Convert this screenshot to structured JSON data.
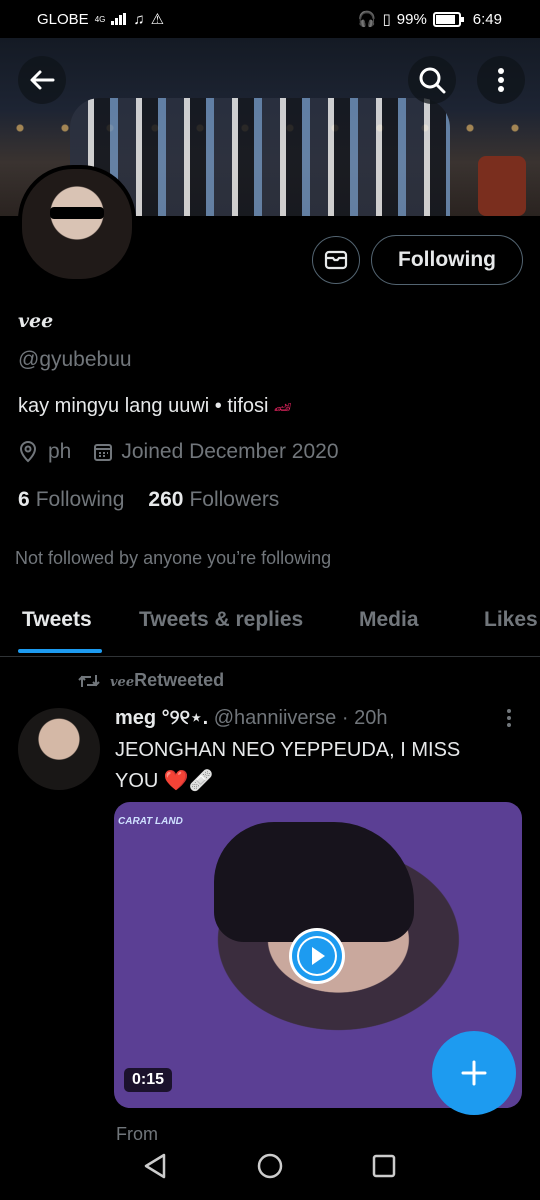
{
  "status_bar": {
    "carrier": "GLOBE",
    "network": "4G",
    "battery": "99%",
    "time": "6:49"
  },
  "profile": {
    "display_name": "vee",
    "handle": "@gyubebuu",
    "bio": "kay mingyu lang uuwi • tifosi",
    "location": "ph",
    "joined": "Joined December 2020",
    "following_count": "6",
    "following_label": "Following",
    "followers_count": "260",
    "followers_label": "Followers",
    "not_followed_note": "Not followed by anyone you’re following",
    "follow_button_label": "Following"
  },
  "tabs": [
    {
      "label": "Tweets",
      "active": true
    },
    {
      "label": "Tweets & replies",
      "active": false
    },
    {
      "label": "Media",
      "active": false
    },
    {
      "label": "Likes",
      "active": false
    }
  ],
  "tweet": {
    "retweeted_by": "vee",
    "retweeted_label": "Retweeted",
    "author_name": "meg °୨୧⋆.",
    "author_handle": "@hanniiverse",
    "time": "· 20h",
    "text": "JEONGHAN NEO YEPPEUDA, I MISS YOU ❤️🩹",
    "video_duration": "0:15",
    "video_watermark": "CARAT LAND",
    "footer_text": "From"
  },
  "colors": {
    "accent": "#1d9bf0",
    "background": "#000000",
    "secondary_text": "#71767b"
  }
}
